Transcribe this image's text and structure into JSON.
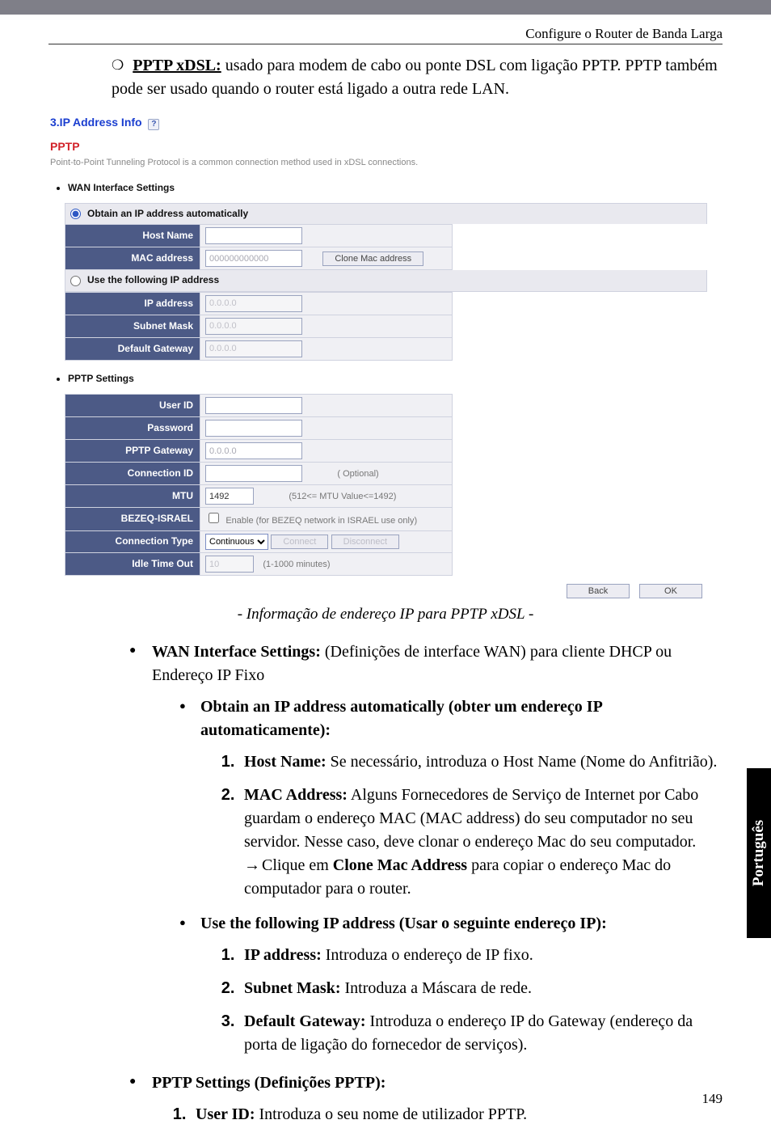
{
  "header": {
    "title": "Configure o Router de Banda Larga"
  },
  "intro": {
    "label": "PPTP xDSL:",
    "text_before": "usado para modem de cabo ou ponte DSL com ligação PPTP. PPTP também pode ser usado quando o router está ligado a outra rede LAN."
  },
  "screenshot": {
    "section_title": "3.IP Address Info",
    "pptp_title": "PPTP",
    "pptp_desc": "Point-to-Point Tunneling Protocol is a common connection method used in xDSL connections.",
    "wan_heading": "WAN Interface Settings",
    "radio_auto": "Obtain an IP address automatically",
    "radio_static": "Use the following IP address",
    "fields_auto": {
      "host_name": {
        "label": "Host Name",
        "value": ""
      },
      "mac": {
        "label": "MAC address",
        "value": "000000000000",
        "clone_btn": "Clone Mac address"
      }
    },
    "fields_static": {
      "ip": {
        "label": "IP address",
        "value": "0.0.0.0"
      },
      "mask": {
        "label": "Subnet Mask",
        "value": "0.0.0.0"
      },
      "gw": {
        "label": "Default Gateway",
        "value": "0.0.0.0"
      }
    },
    "pptp_heading": "PPTP Settings",
    "fields_pptp": {
      "user": {
        "label": "User ID",
        "value": ""
      },
      "pass": {
        "label": "Password",
        "value": ""
      },
      "gateway": {
        "label": "PPTP Gateway",
        "value": "0.0.0.0"
      },
      "conn_id": {
        "label": "Connection ID",
        "value": "",
        "hint": "( Optional)"
      },
      "mtu": {
        "label": "MTU",
        "value": "1492",
        "hint": "(512<= MTU Value<=1492)"
      },
      "bezeq": {
        "label": "BEZEQ-ISRAEL",
        "hint": "Enable (for BEZEQ network in ISRAEL use only)"
      },
      "conn_type": {
        "label": "Connection Type",
        "value": "Continuous",
        "connect": "Connect",
        "disconnect": "Disconnect"
      },
      "idle": {
        "label": "Idle Time Out",
        "value": "10",
        "hint": "(1-1000 minutes)"
      }
    },
    "back_btn": "Back",
    "ok_btn": "OK"
  },
  "caption": "- Informação de endereço IP para PPTP xDSL -",
  "doc": {
    "wan_title": "WAN Interface Settings:",
    "wan_body": "(Definições de interface WAN) para cliente DHCP ou Endereço IP Fixo",
    "obtain_title": "Obtain an IP address automatically (obter um endereço IP automaticamente):",
    "obtain_1_title": "Host Name:",
    "obtain_1_body": "Se necessário, introduza o Host Name (Nome do Anfitrião).",
    "obtain_2_title": "MAC Address:",
    "obtain_2_body": "Alguns Fornecedores de Serviço de Internet por Cabo guardam o endereço MAC (MAC address) do seu computador no seu servidor. Nesse caso, deve clonar o endereço Mac do seu computador.",
    "obtain_2_arrow": "Clique em",
    "obtain_2_bold": "Clone Mac Address",
    "obtain_2_tail": "para copiar o endereço Mac do computador para o router.",
    "static_title": "Use the following IP address (Usar o seguinte endereço IP):",
    "static_1_title": "IP address:",
    "static_1_body": "Introduza o endereço de IP fixo.",
    "static_2_title": "Subnet Mask:",
    "static_2_body": "Introduza a Máscara de rede.",
    "static_3_title": "Default Gateway:",
    "static_3_body": "Introduza o endereço IP do Gateway (endereço da porta de ligação do fornecedor de serviços).",
    "pptp_title": "PPTP Settings (Definições PPTP):",
    "pptp_1_title": "User ID:",
    "pptp_1_body": "Introduza o seu nome de utilizador PPTP."
  },
  "side_tab": "Português",
  "page_number": "149"
}
